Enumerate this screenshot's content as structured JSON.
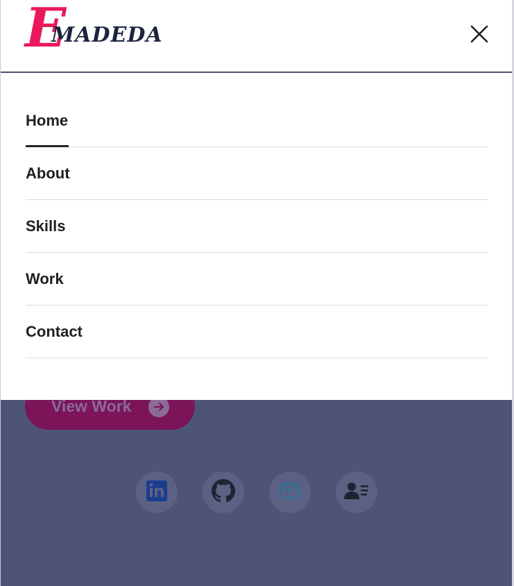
{
  "logo": {
    "initial": "E",
    "rest": "MADEDA"
  },
  "nav": {
    "items": [
      {
        "label": "Home",
        "active": true
      },
      {
        "label": "About",
        "active": false
      },
      {
        "label": "Skills",
        "active": false
      },
      {
        "label": "Work",
        "active": false
      },
      {
        "label": "Contact",
        "active": false
      }
    ]
  },
  "hero": {
    "view_work_label": "View Work"
  },
  "social": {
    "icons": [
      "linkedin-icon",
      "github-icon",
      "mail-icon",
      "resume-icon"
    ]
  },
  "colors": {
    "brand_pink": "#e9195c",
    "logo_text": "#1b2540",
    "overlay": "#4e5478",
    "button_bg": "#7b1459"
  }
}
